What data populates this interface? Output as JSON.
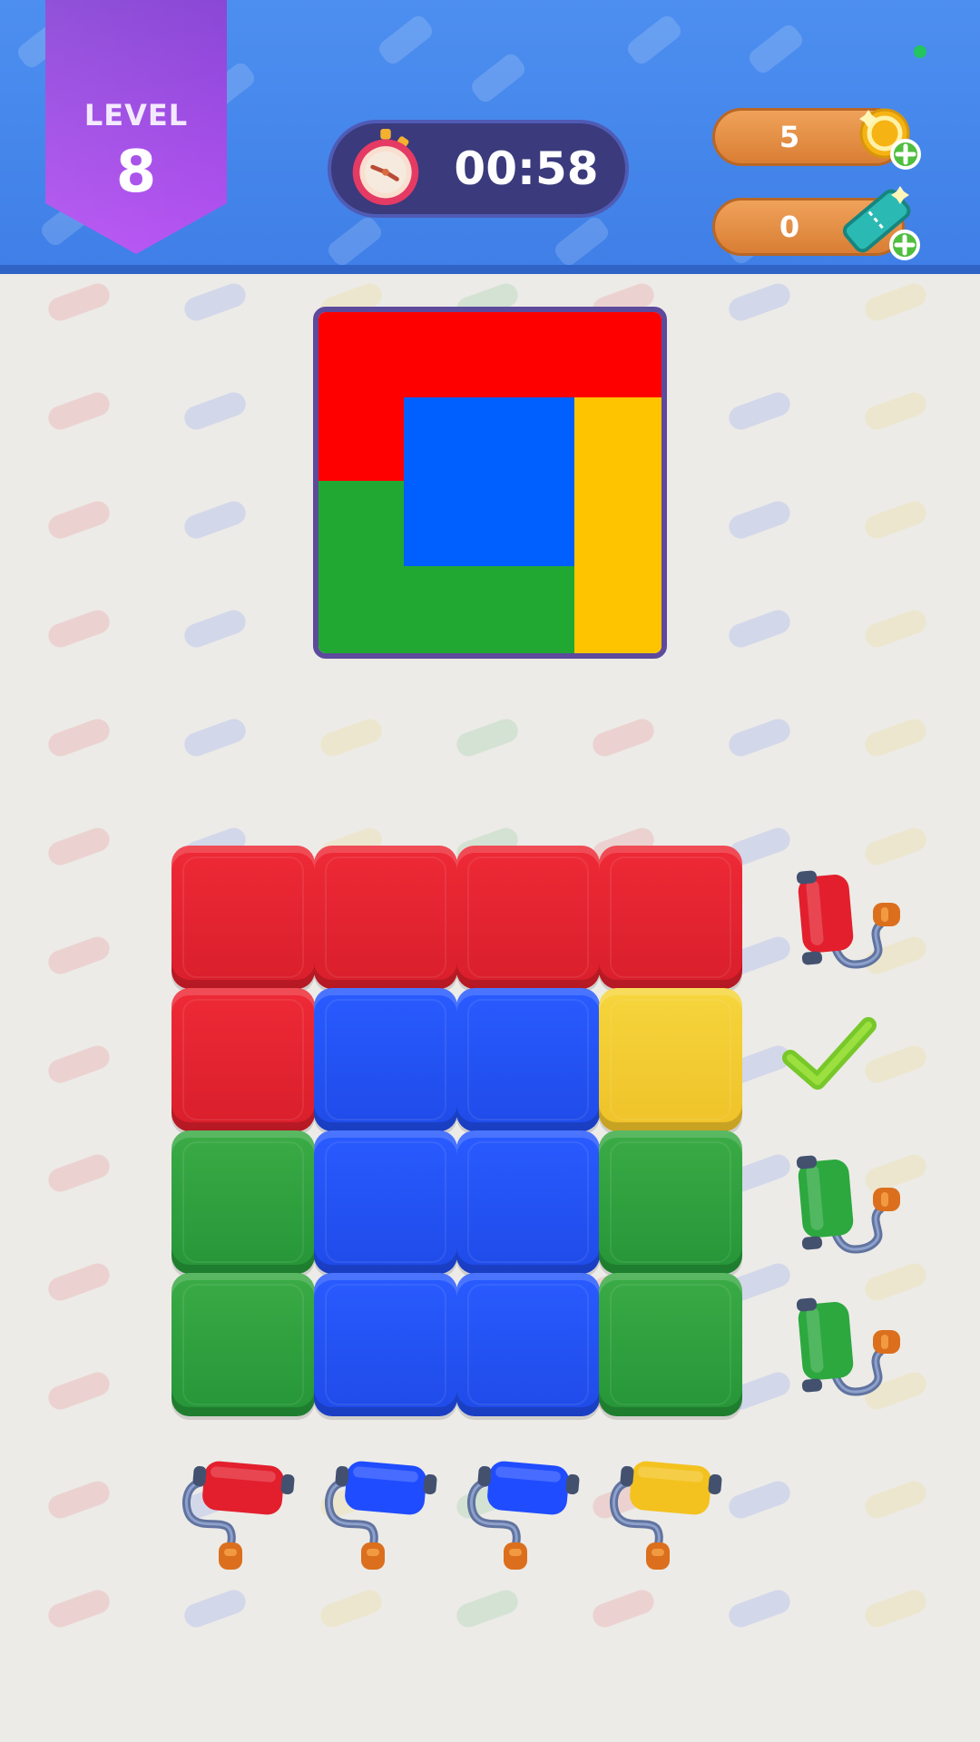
{
  "header": {
    "level_label": "LEVEL",
    "level_number": "8",
    "timer": "00:58",
    "coins": "5",
    "tickets": "0"
  },
  "colors": {
    "red": "#e31f2d",
    "blue": "#1f4cff",
    "yellow": "#f4c21f",
    "green": "#2ca83f"
  },
  "target_pattern": {
    "regions": [
      {
        "color": "red",
        "shape": "top-left L"
      },
      {
        "color": "blue",
        "shape": "center square"
      },
      {
        "color": "yellow",
        "shape": "right bar"
      },
      {
        "color": "green",
        "shape": "bottom-left L"
      }
    ]
  },
  "board": {
    "rows": [
      [
        "red",
        "red",
        "red",
        "red"
      ],
      [
        "red",
        "blue",
        "blue",
        "yellow"
      ],
      [
        "green",
        "blue",
        "blue",
        "green"
      ],
      [
        "green",
        "blue",
        "blue",
        "green"
      ]
    ],
    "row_rollers": [
      {
        "color": "red",
        "state": "available"
      },
      {
        "color": "none",
        "state": "complete",
        "icon": "checkmark-icon"
      },
      {
        "color": "green",
        "state": "available"
      },
      {
        "color": "green",
        "state": "available"
      }
    ],
    "column_rollers": [
      {
        "color": "red",
        "state": "available"
      },
      {
        "color": "blue",
        "state": "available"
      },
      {
        "color": "blue",
        "state": "available"
      },
      {
        "color": "yellow",
        "state": "available"
      }
    ]
  },
  "icons": {
    "timer": "stopwatch-icon",
    "coins": "coin-plus-icon",
    "tickets": "ticket-plus-icon",
    "rollers": "paint-roller-icon"
  }
}
